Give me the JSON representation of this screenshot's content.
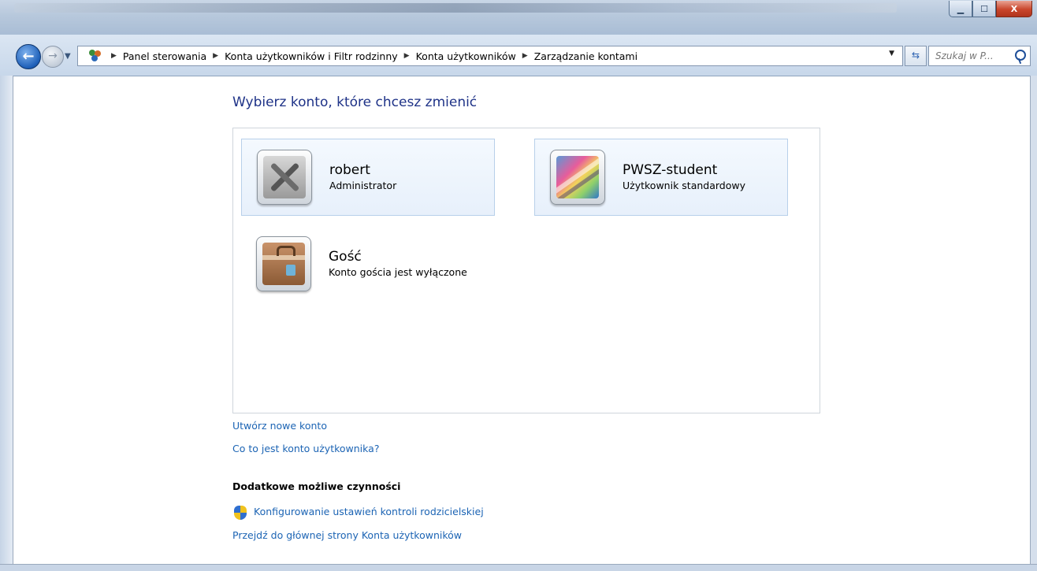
{
  "window": {
    "minimize_icon": "minimize-icon",
    "maximize_icon": "maximize-icon",
    "close_label": "X"
  },
  "nav": {
    "breadcrumbs": [
      "Panel sterowania",
      "Konta użytkowników i Filtr rodzinny",
      "Konta użytkowników",
      "Zarządzanie kontami"
    ],
    "search_placeholder": "Szukaj w P..."
  },
  "main": {
    "heading": "Wybierz konto, które chcesz zmienić",
    "accounts": [
      {
        "name": "robert",
        "type": "Administrator",
        "icon": "tools-icon"
      },
      {
        "name": "PWSZ-student",
        "type": "Użytkownik standardowy",
        "icon": "abstract-picture-icon"
      },
      {
        "name": "Gość",
        "type": "Konto gościa jest wyłączone",
        "icon": "suitcase-icon"
      }
    ],
    "links": {
      "create_account": "Utwórz nowe konto",
      "what_is_account": "Co to jest konto użytkownika?"
    },
    "additional": {
      "title": "Dodatkowe możliwe czynności",
      "parental_controls": "Konfigurowanie ustawień kontroli rodzicielskiej",
      "go_to_main": "Przejdź do głównej strony Konta użytkowników"
    }
  },
  "colors": {
    "link": "#1c64b4",
    "heading": "#1e3287"
  }
}
